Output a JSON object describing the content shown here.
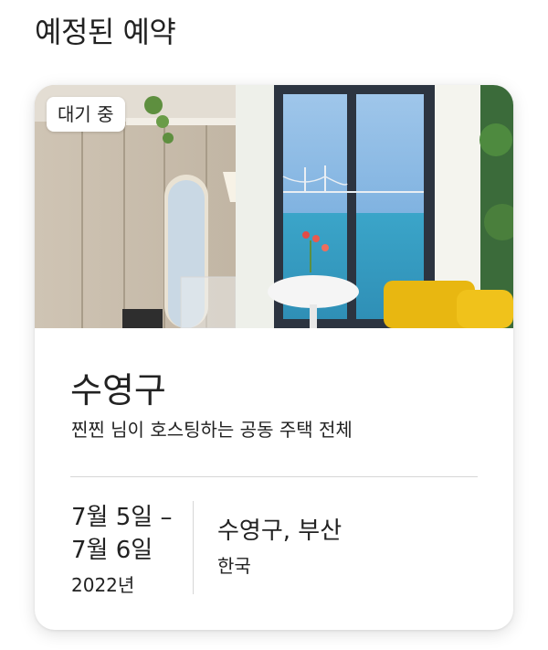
{
  "section": {
    "title": "예정된 예약"
  },
  "reservation": {
    "status_badge": "대기 중",
    "listing_title": "수영구",
    "listing_subtitle": "찐찐 님이 호스팅하는 공동 주택 전체",
    "date_start": "7월 5일 –",
    "date_end": "7월 6일",
    "year": "2022년",
    "location_city": "수영구, 부산",
    "location_country": "한국"
  },
  "colors": {
    "text": "#222222",
    "divider": "#d6d6d6",
    "card_bg": "#ffffff"
  },
  "icons": {
    "photo": "listing-photo"
  }
}
